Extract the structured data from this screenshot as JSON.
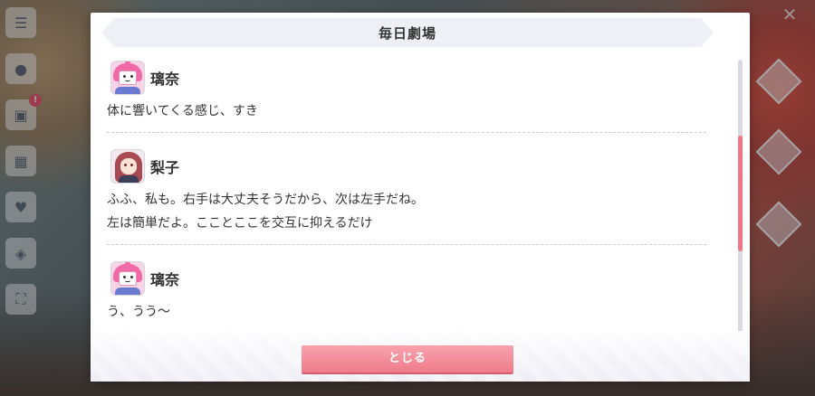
{
  "dialog": {
    "title": "毎日劇場",
    "close_label": "とじる"
  },
  "messages": [
    {
      "speaker": "璃奈",
      "avatar": "rina",
      "lines": [
        "体に響いてくる感じ、すき"
      ]
    },
    {
      "speaker": "梨子",
      "avatar": "riko",
      "lines": [
        "ふふ、私も。右手は大丈夫そうだから、次は左手だね。",
        "左は簡単だよ。こことここを交互に抑えるだけ"
      ]
    },
    {
      "speaker": "璃奈",
      "avatar": "rina",
      "lines": [
        "う、うう〜"
      ]
    }
  ],
  "side_menu": {
    "items": [
      "menu-icon",
      "chat-icon",
      "gift-box-icon",
      "present-icon",
      "heart-icon",
      "costume-icon",
      "fullscreen-icon"
    ],
    "badge": "!"
  },
  "colors": {
    "accent": "#f07c8b",
    "title_bar": "#eef0f6",
    "scroll_thumb": "#f07585"
  }
}
